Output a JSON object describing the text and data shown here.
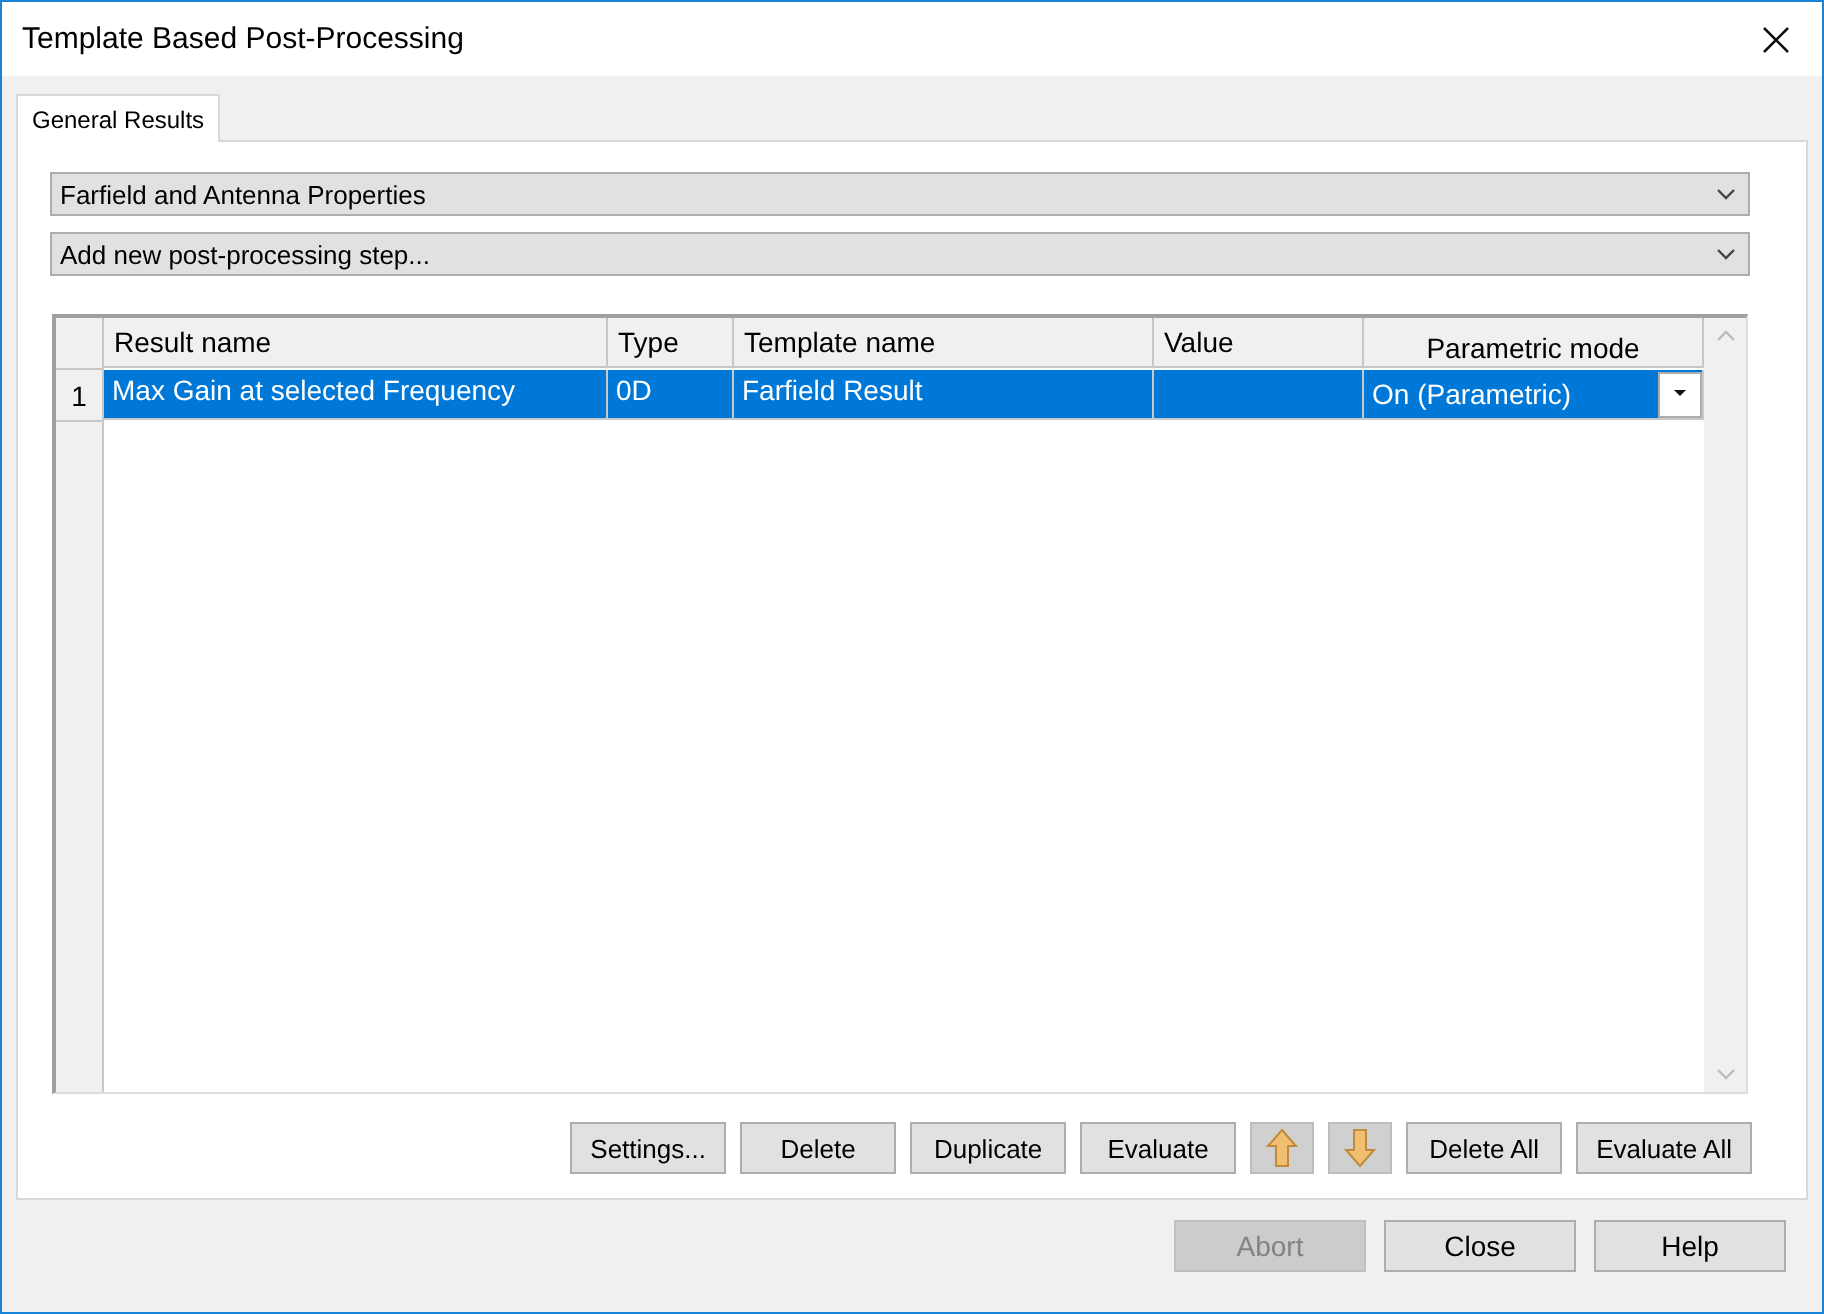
{
  "window": {
    "title": "Template Based Post-Processing"
  },
  "tabs": [
    {
      "label": "General Results",
      "selected": true
    }
  ],
  "dropdowns": [
    {
      "value": "Farfield and Antenna Properties"
    },
    {
      "value": "Add new post-processing step..."
    }
  ],
  "table": {
    "columns": [
      "Result name",
      "Type",
      "Template name",
      "Value",
      "Parametric mode"
    ],
    "rows": [
      {
        "index": "1",
        "selected": true,
        "cells": [
          "Max Gain at selected Frequency",
          "0D",
          "Farfield Result",
          "",
          "On (Parametric)"
        ]
      }
    ]
  },
  "actions": [
    {
      "kind": "text",
      "label": "Settings..."
    },
    {
      "kind": "text",
      "label": "Delete"
    },
    {
      "kind": "text",
      "label": "Duplicate"
    },
    {
      "kind": "text",
      "label": "Evaluate"
    },
    {
      "kind": "up"
    },
    {
      "kind": "down"
    },
    {
      "kind": "text",
      "label": "Delete All"
    },
    {
      "kind": "text",
      "label": "Evaluate All"
    }
  ],
  "footer_buttons": [
    {
      "label": "Abort",
      "disabled": true
    },
    {
      "label": "Close",
      "disabled": false
    },
    {
      "label": "Help",
      "disabled": false
    }
  ]
}
